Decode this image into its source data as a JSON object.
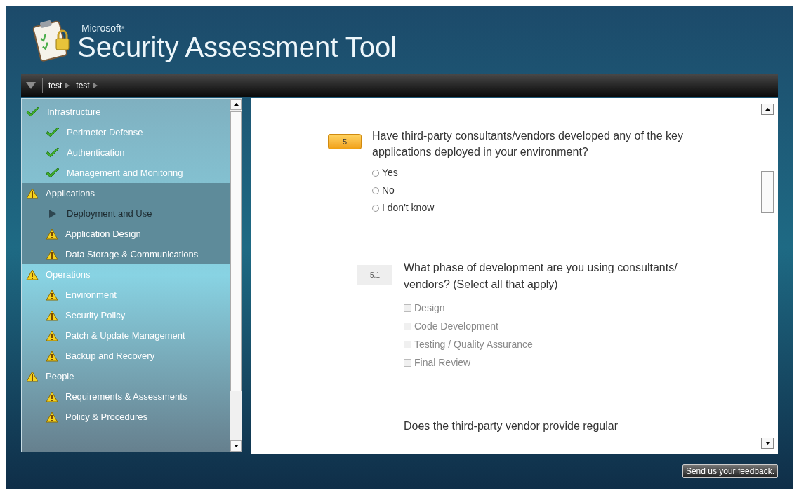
{
  "header": {
    "brand": "Microsoft",
    "trademark": "®",
    "title": "Security Assessment Tool"
  },
  "breadcrumb": [
    "test",
    "test"
  ],
  "sidebar": {
    "sections": [
      {
        "label": "Infrastructure",
        "kind": "complete",
        "selected": false,
        "children": [
          {
            "label": "Perimeter Defense",
            "kind": "complete"
          },
          {
            "label": "Authentication",
            "kind": "complete"
          },
          {
            "label": "Management and Monitoring",
            "kind": "complete"
          }
        ]
      },
      {
        "label": "Applications",
        "kind": "warning",
        "selected": true,
        "children": [
          {
            "label": "Deployment and Use",
            "kind": "current"
          },
          {
            "label": "Application Design",
            "kind": "warning"
          },
          {
            "label": "Data Storage & Communications",
            "kind": "warning"
          }
        ]
      },
      {
        "label": "Operations",
        "kind": "warning",
        "selected": false,
        "children": [
          {
            "label": "Environment",
            "kind": "warning"
          },
          {
            "label": "Security Policy",
            "kind": "warning"
          },
          {
            "label": "Patch & Update Management",
            "kind": "warning"
          },
          {
            "label": "Backup and Recovery",
            "kind": "warning"
          }
        ]
      },
      {
        "label": "People",
        "kind": "warning",
        "selected": false,
        "children": [
          {
            "label": "Requirements & Assessments",
            "kind": "warning"
          },
          {
            "label": "Policy & Procedures",
            "kind": "warning"
          }
        ]
      }
    ]
  },
  "questions": [
    {
      "number": "5",
      "text": "Have third-party consultants/vendors developed any of the key applications deployed in your environment?",
      "kind": "radio",
      "disabled": false,
      "options": [
        {
          "label": "Yes",
          "selected": false
        },
        {
          "label": "No",
          "selected": false
        },
        {
          "label": "I don't know",
          "selected": false
        }
      ]
    },
    {
      "number": "5.1",
      "text": "What phase of development are you using consultants/ vendors? (Select all that apply)",
      "kind": "checkbox",
      "disabled": true,
      "options": [
        {
          "label": "Design",
          "checked": false
        },
        {
          "label": "Code Development",
          "checked": false
        },
        {
          "label": "Testing / Quality Assurance",
          "checked": false
        },
        {
          "label": "Final Review",
          "checked": false
        }
      ]
    },
    {
      "text": "Does the third-party vendor provide regular",
      "kind": "partial",
      "disabled": false
    }
  ],
  "feedback_button": "Send us your feedback."
}
